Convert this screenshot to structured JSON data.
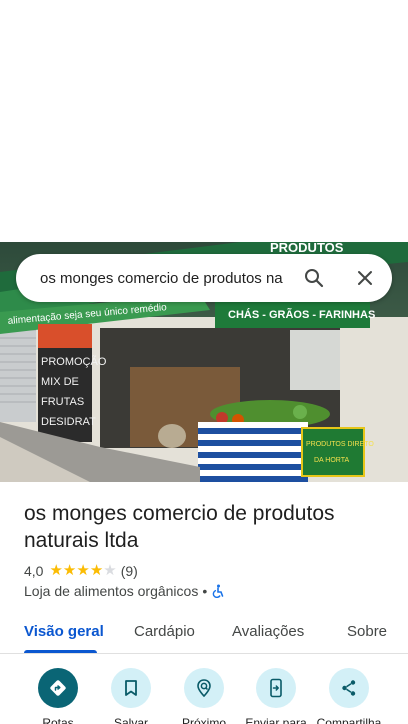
{
  "search": {
    "query": "os monges comercio de produtos na",
    "search_icon": "search-icon",
    "close_icon": "close-icon"
  },
  "photo": {
    "description_icon": "storefront-photo",
    "sign_top": "PRODUTOS",
    "sign_banner": "alimentação seja seu único remédio",
    "sign_green": "CHÁS - GRÃOS - FARINHAS",
    "chalkboard": [
      "PROMOÇÃO",
      "MIX DE",
      "FRUTAS",
      "DESIDRAT"
    ],
    "crate_sign": [
      "PRODUTOS DIRETO",
      "DA HORTA"
    ]
  },
  "place": {
    "title": "os monges comercio de produtos naturais ltda",
    "rating": "4,0",
    "rating_value": 4,
    "rating_max": 5,
    "reviews": "(9)",
    "category": "Loja de alimentos orgânicos",
    "separator": "•",
    "accessibility_icon": "wheelchair-icon"
  },
  "tabs": [
    {
      "label": "Visão geral",
      "active": true
    },
    {
      "label": "Cardápio",
      "active": false
    },
    {
      "label": "Avaliações",
      "active": false
    },
    {
      "label": "Sobre",
      "active": false
    }
  ],
  "actions": [
    {
      "label": "Rotas",
      "icon": "directions-icon"
    },
    {
      "label": "Salvar",
      "icon": "bookmark-icon"
    },
    {
      "label": "Próximo",
      "icon": "nearby-icon"
    },
    {
      "label": "Enviar para",
      "icon": "send-to-phone-icon"
    },
    {
      "label": "Compartilha",
      "icon": "share-icon"
    }
  ],
  "colors": {
    "accent": "#0b57d0",
    "star": "#fbbc04",
    "primary_action": "#0a6575",
    "action_bg": "#d3f0f7"
  }
}
